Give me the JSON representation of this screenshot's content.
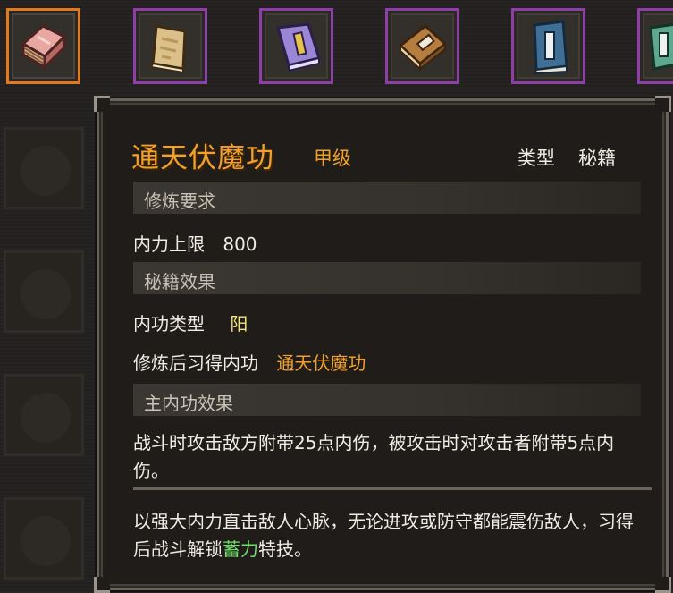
{
  "inventory": {
    "slots": [
      {
        "icon": "pink-manual-icon",
        "selected": true
      },
      {
        "icon": "tan-manual-icon",
        "selected": false
      },
      {
        "icon": "purple-manual-icon",
        "selected": false
      },
      {
        "icon": "brown-manual-icon",
        "selected": false
      },
      {
        "icon": "blue-manual-icon",
        "selected": false
      },
      {
        "icon": "teal-manual-icon",
        "selected": false
      }
    ]
  },
  "tooltip": {
    "title": "通天伏魔功",
    "grade": "甲级",
    "type_label": "类型",
    "type_value": "秘籍",
    "sections": {
      "requirements": "修炼要求",
      "effects": "秘籍效果",
      "main_effect": "主内功效果"
    },
    "requirement": {
      "label": "内力上限",
      "value": "800"
    },
    "internal_type": {
      "label": "内功类型",
      "value": "阳"
    },
    "learned": {
      "label": "修炼后习得内功",
      "value": "通天伏魔功"
    },
    "main_effect_text": "战斗时攻击敌方附带25点内伤，被攻击时对攻击者附带5点内伤。",
    "description_prefix": "以强大内力直击敌人心脉，无论进攻或防守都能震伤敌人，习得后战斗解锁",
    "description_highlight": "蓄力",
    "description_suffix": "特技。"
  },
  "colors": {
    "title": "#f2a02a",
    "highlight_green": "#6fe06a",
    "yang_value": "#f6e27a",
    "slot_border": "#8e3fa7",
    "slot_selected_border": "#e07a1f"
  }
}
